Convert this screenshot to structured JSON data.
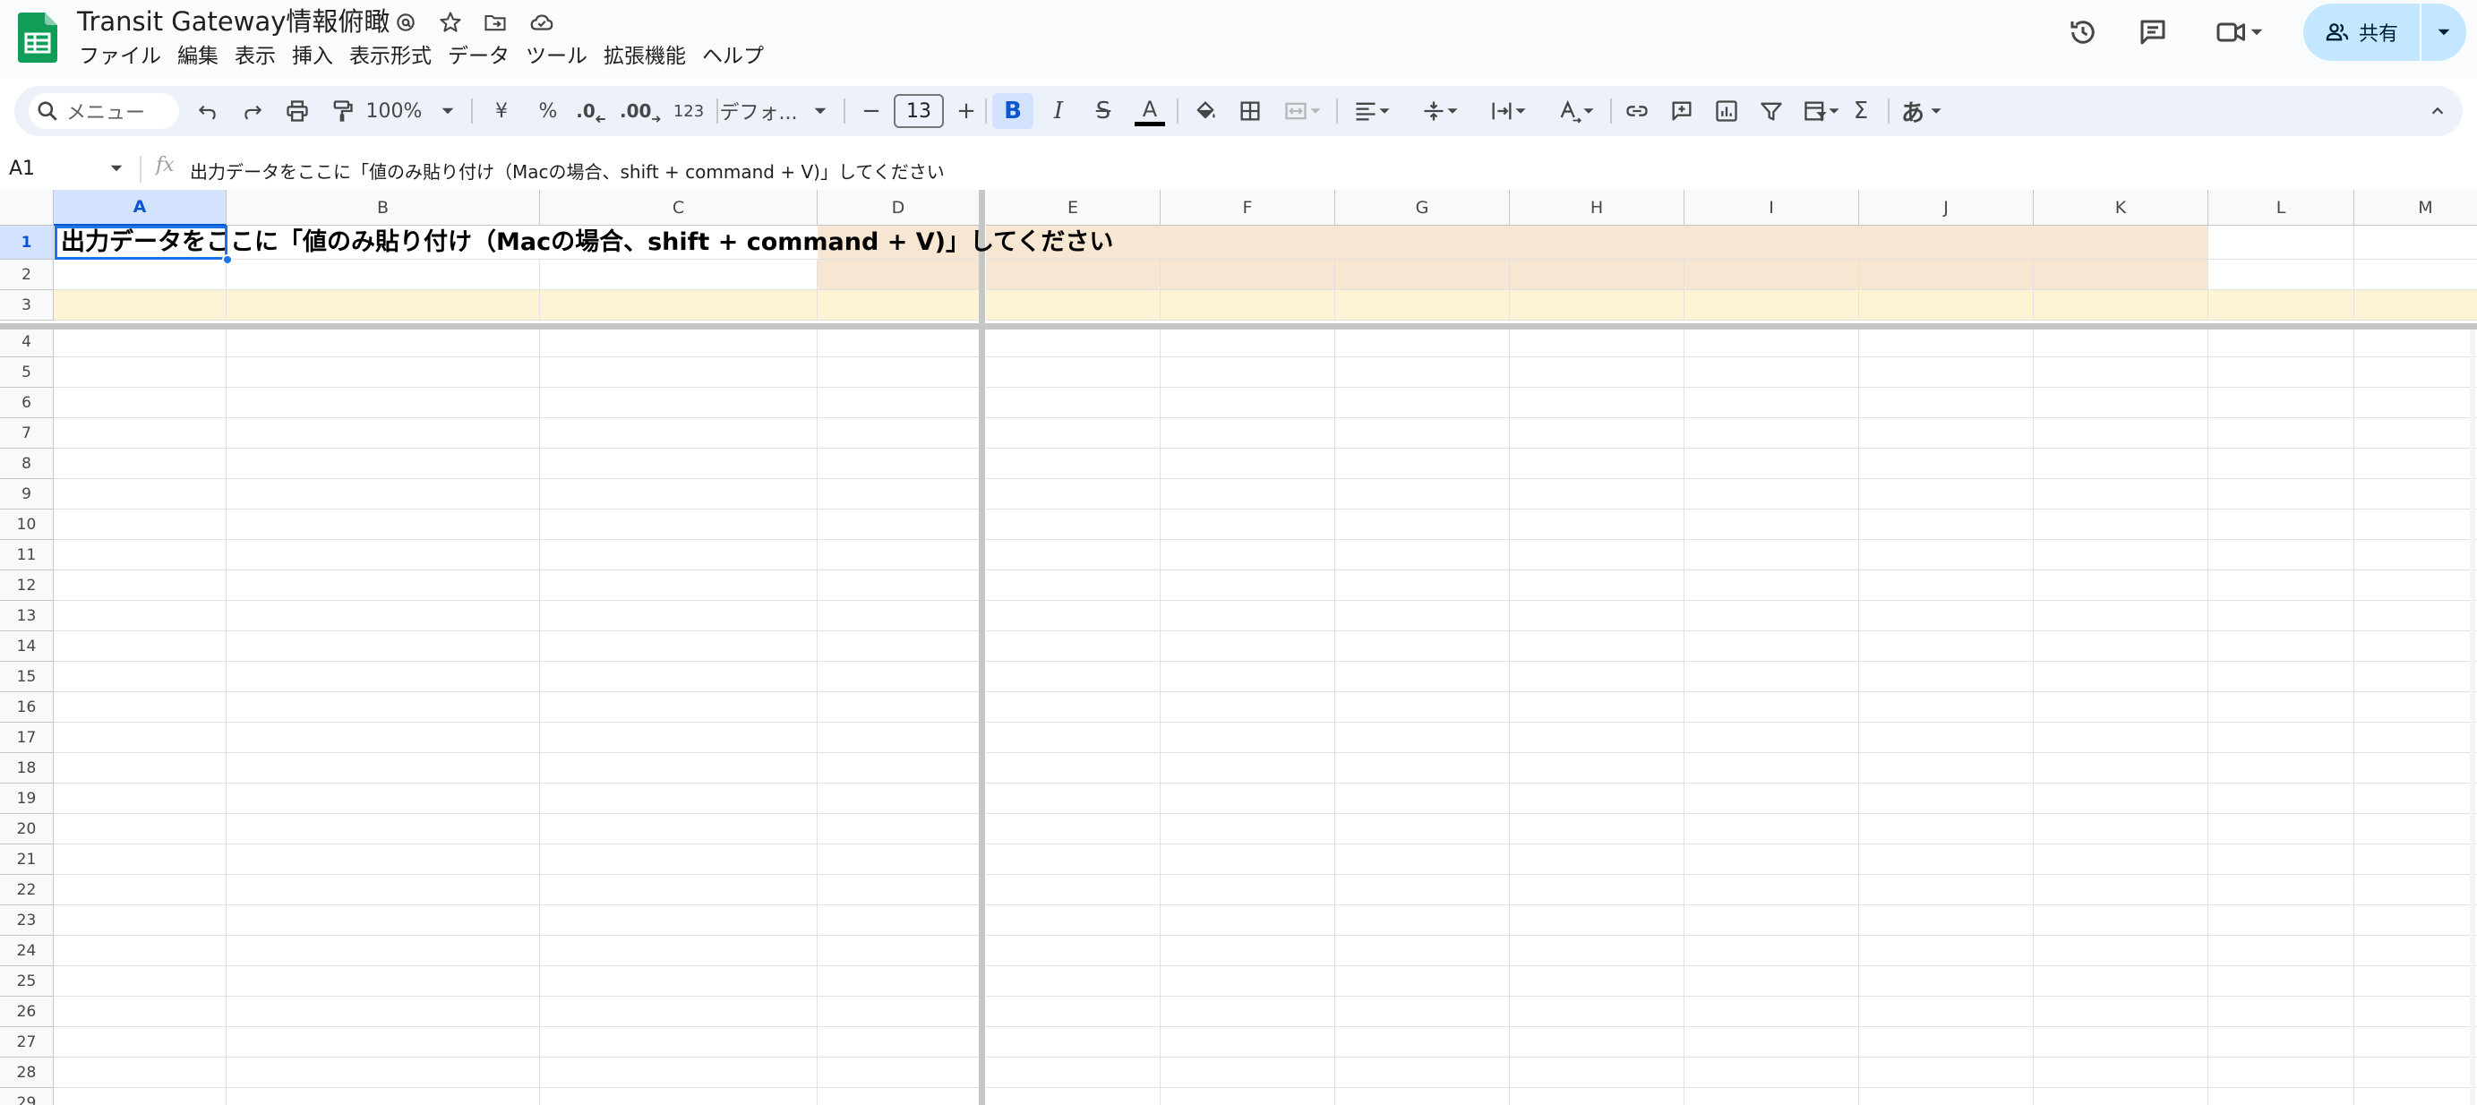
{
  "document": {
    "title": "Transit Gateway情報俯瞰"
  },
  "menu": [
    "ファイル",
    "編集",
    "表示",
    "挿入",
    "表示形式",
    "データ",
    "ツール",
    "拡張機能",
    "ヘルプ"
  ],
  "share": {
    "label": "共有"
  },
  "toolbar": {
    "search_placeholder": "メニュー",
    "zoom": "100%",
    "currency": "¥",
    "percent": "%",
    "decrease_decimal": ".0",
    "increase_decimal": ".00",
    "number_format": "123",
    "font": "デフォ...",
    "font_size": "13",
    "minus": "−",
    "plus": "+",
    "bold": "B",
    "italic": "I",
    "strikethrough": "S",
    "text_color_letter": "A",
    "input_tool": "あ",
    "function_symbol": "Σ"
  },
  "formula_bar": {
    "cell_ref": "A1",
    "fx": "fx",
    "content": "出力データをここに「値のみ貼り付け（Macの場合、shift + command + V)」してください"
  },
  "sheet": {
    "columns": [
      "A",
      "B",
      "C",
      "D",
      "E",
      "F",
      "G",
      "H",
      "I",
      "J",
      "K",
      "L",
      "M"
    ],
    "rows": [
      "1",
      "2",
      "3",
      "4",
      "5",
      "6",
      "7",
      "8",
      "9",
      "10",
      "11",
      "12",
      "13",
      "14",
      "15",
      "16",
      "17",
      "18",
      "19",
      "20",
      "21",
      "22",
      "23",
      "24",
      "25",
      "26",
      "27",
      "28",
      "29"
    ],
    "selected_cell": "A1",
    "a1_value": "出力データをここに「値のみ貼り付け（Macの場合、shift + command + V)」してください",
    "colors": {
      "orange_fill": "#f6e6d2",
      "yellow_fill": "#fef3d5",
      "selection": "#1a73e8"
    }
  },
  "colors": {
    "sheets_green": "#0f9d58",
    "share_bg": "#c2e7ff",
    "toolbar_bg": "#edf2fa",
    "active_blue": "#0b57d0"
  }
}
